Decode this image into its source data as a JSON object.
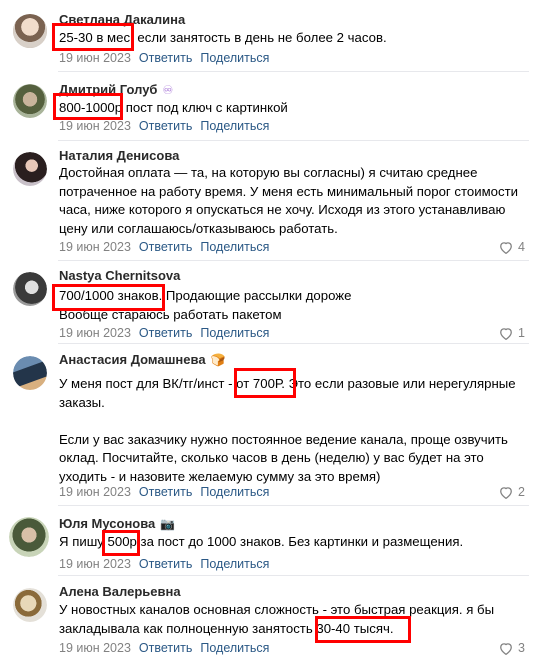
{
  "comments": [
    {
      "author": "Светлана Дакалина",
      "badge": "",
      "text": "25-30 в мес, если занятость в день не более 2 часов.",
      "date": "19 июн 2023",
      "reply": "Ответить",
      "share": "Поделиться",
      "likes": "",
      "avatar_color": "#b8a89a",
      "highlight": "25-30 в мес"
    },
    {
      "author": "Дмитрий Голуб",
      "badge": "♾",
      "text": "800-1000р пост под ключ с картинкой",
      "date": "19 июн 2023",
      "reply": "Ответить",
      "share": "Поделиться",
      "likes": "",
      "avatar_color": "#6d7a5e",
      "highlight": "800-1000р"
    },
    {
      "author": "Наталия Денисова",
      "badge": "",
      "text": "Достойная оплата — та, на которую вы согласны) я считаю среднее\nпотраченное на работу время. У меня есть минимальный порог стоимости\nчаса, ниже которого я опускаться не хочу. Исходя из этого устанавливаю\nцену или соглашаюсь/отказываюсь работать.",
      "date": "19 июн 2023",
      "reply": "Ответить",
      "share": "Поделиться",
      "likes": "4",
      "avatar_color": "#3a2c2c",
      "highlight": ""
    },
    {
      "author": "Nastya Chernitsova",
      "badge": "",
      "text": "700/1000 знаков. Продающие рассылки дороже\nВообще стараюсь работать пакетом",
      "date": "19 июн 2023",
      "reply": "Ответить",
      "share": "Поделиться",
      "likes": "1",
      "avatar_color": "#5a5a5a",
      "highlight": "700/1000 знаков"
    },
    {
      "author": "Анастасия Домашнева",
      "badge": "🍞",
      "text": "У меня пост для ВК/тг/инст - от 700Р. Это если разовые или нерегулярные\nзаказы.\n\nЕсли у вас заказчику нужно постоянное ведение канала, проще озвучить\nоклад. Посчитайте, сколько часов в день (неделю) у вас будет на это\nуходить - и назовите желаемую сумму за это время)",
      "date": "19 июн 2023",
      "reply": "Ответить",
      "share": "Поделиться",
      "likes": "2",
      "avatar_color": "#2f4a6a",
      "highlight": "от 700Р."
    },
    {
      "author": "Юля Мусонова",
      "badge": "📷",
      "text": "Я пишу 500р за пост до 1000 знаков. Без картинки и размещения.",
      "date": "19 июн 2023",
      "reply": "Ответить",
      "share": "Поделиться",
      "likes": "",
      "avatar_color": "#8a9a78",
      "highlight": "500р"
    },
    {
      "author": "Алена Валерьевна",
      "badge": "",
      "text": "У новостных каналов основная сложность - это быстрая реакция. я бы\nзакладывала как полноценную занятость 30-40 тысяч.",
      "date": "19 июн 2023",
      "reply": "Ответить",
      "share": "Поделиться",
      "likes": "3",
      "avatar_color": "#c9b28a",
      "highlight": "30-40 тысяч."
    }
  ],
  "colors": {
    "link": "#2a5885",
    "meta": "#828282",
    "highlight_border": "#ff0000"
  }
}
